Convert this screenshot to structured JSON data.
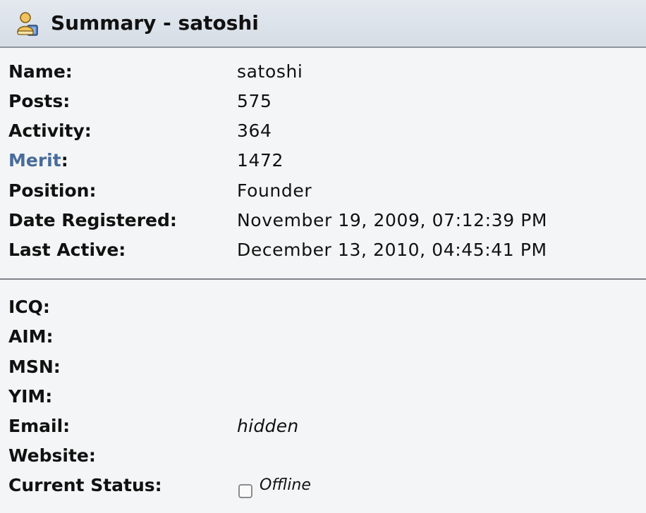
{
  "header": {
    "icon": "user-profile-icon",
    "title": "Summary - satoshi"
  },
  "summary": {
    "name_label": "Name:",
    "name_value": "satoshi",
    "posts_label": "Posts:",
    "posts_value": "575",
    "activity_label": "Activity:",
    "activity_value": "364",
    "merit_link": "Merit",
    "merit_colon": ":",
    "merit_value": "1472",
    "position_label": "Position:",
    "position_value": "Founder",
    "date_registered_label": "Date Registered:",
    "date_registered_value": "November 19, 2009, 07:12:39 PM",
    "last_active_label": "Last Active:",
    "last_active_value": "December 13, 2010, 04:45:41 PM"
  },
  "contact": {
    "icq_label": "ICQ:",
    "aim_label": "AIM:",
    "msn_label": "MSN:",
    "yim_label": "YIM:",
    "email_label": "Email:",
    "email_value": "hidden",
    "website_label": "Website:",
    "status_label": "Current Status:",
    "status_value": "Offline",
    "status_icon": "offline-status-icon"
  },
  "colors": {
    "merit_link": "#476c9b",
    "header_bg": "#dde3ea",
    "page_bg": "#f4f5f6"
  }
}
